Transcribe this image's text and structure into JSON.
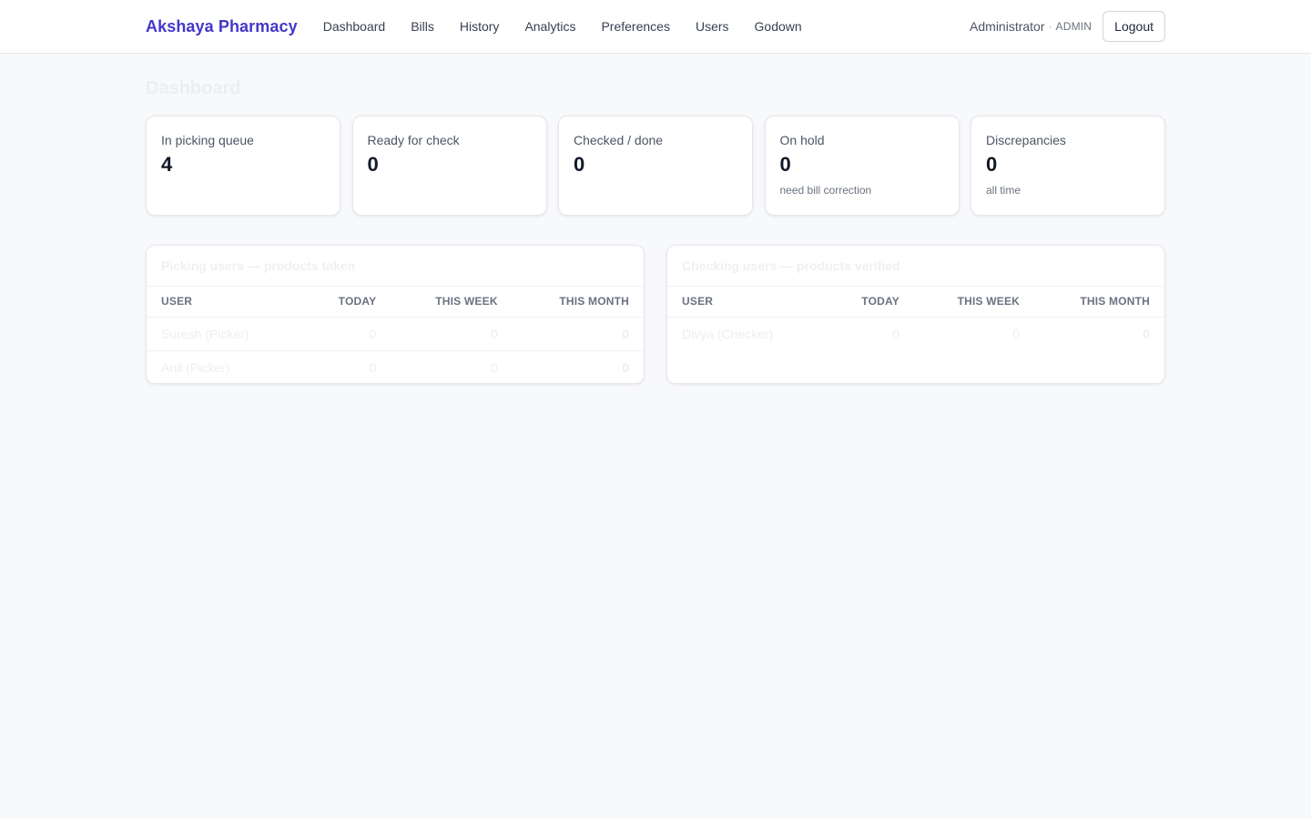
{
  "header": {
    "brand": "Akshaya Pharmacy",
    "nav": [
      "Dashboard",
      "Bills",
      "History",
      "Analytics",
      "Preferences",
      "Users",
      "Godown"
    ],
    "user_name": "Administrator",
    "separator": "·",
    "user_role": "ADMIN",
    "logout_label": "Logout"
  },
  "page": {
    "title": "Dashboard"
  },
  "stats": [
    {
      "label": "In picking queue",
      "value": "4",
      "note": ""
    },
    {
      "label": "Ready for check",
      "value": "0",
      "note": ""
    },
    {
      "label": "Checked / done",
      "value": "0",
      "note": ""
    },
    {
      "label": "On hold",
      "value": "0",
      "note": "need bill correction"
    },
    {
      "label": "Discrepancies",
      "value": "0",
      "note": "all time"
    }
  ],
  "picking_table": {
    "title": "Picking users — products taken",
    "columns": [
      "USER",
      "TODAY",
      "THIS WEEK",
      "THIS MONTH"
    ],
    "rows": [
      {
        "user": "Suresh (Picker)",
        "today": "0",
        "week": "0",
        "month": "0"
      },
      {
        "user": "Anil (Picker)",
        "today": "0",
        "week": "0",
        "month": "0"
      }
    ]
  },
  "checking_table": {
    "title": "Checking users — products verified",
    "columns": [
      "USER",
      "TODAY",
      "THIS WEEK",
      "THIS MONTH"
    ],
    "rows": [
      {
        "user": "Divya (Checker)",
        "today": "0",
        "week": "0",
        "month": "0"
      }
    ]
  },
  "colors": {
    "brand": "#4338ca",
    "background": "#f8f9fb",
    "card": "#ffffff",
    "border": "#e5e7eb"
  }
}
